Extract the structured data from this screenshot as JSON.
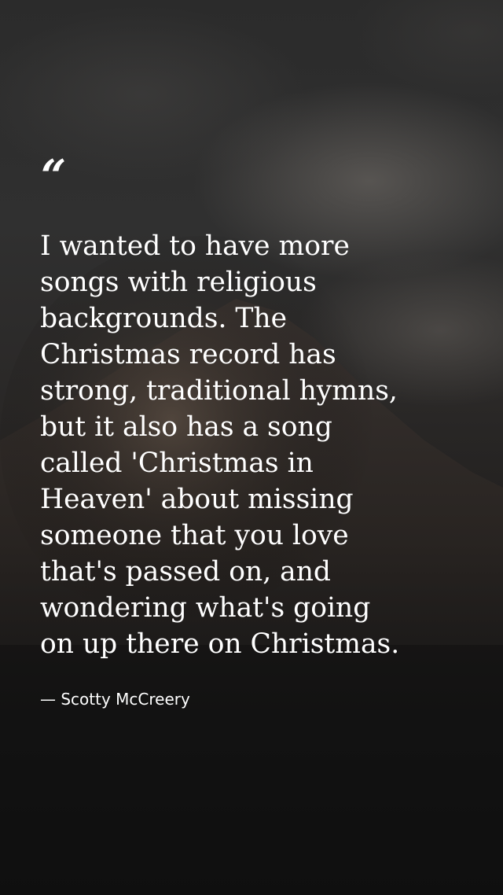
{
  "quote": {
    "mark": "“",
    "text": "I wanted to have more\nsongs with religious\nbackgrounds. The\nChristmas record has\nstrong, traditional hymns,\nbut it also has a song\ncalled 'Christmas in\nHeaven' about missing\nsomeone that you love\nthat's passed on, and\nwondering what's going\non up there on Christmas.",
    "author": "— Scotty McCreery"
  },
  "colors": {
    "text": "#ffffff",
    "sky": "#2e2e2e",
    "ground": "#111111"
  }
}
